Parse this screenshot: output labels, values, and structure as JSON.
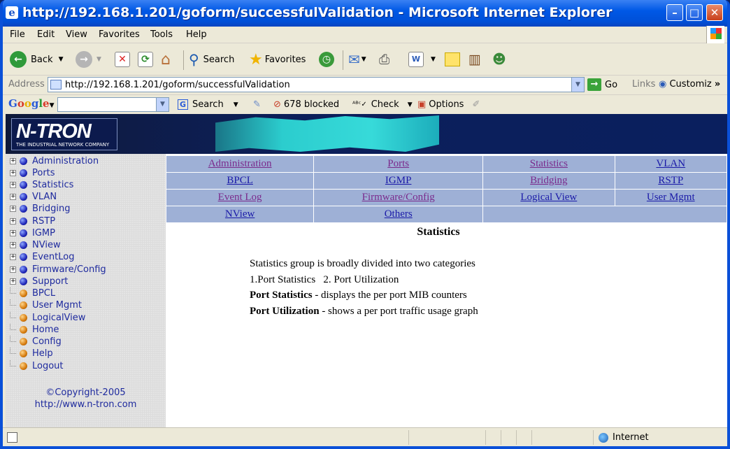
{
  "window": {
    "title": "http://192.168.1.201/goform/successfulValidation - Microsoft Internet Explorer",
    "icon": "ie-icon"
  },
  "menubar": {
    "items": [
      "File",
      "Edit",
      "View",
      "Favorites",
      "Tools",
      "Help"
    ]
  },
  "toolbar": {
    "back": "Back",
    "search": "Search",
    "favorites": "Favorites"
  },
  "address": {
    "label": "Address",
    "url": "http://192.168.1.201/goform/successfulValidation",
    "go": "Go",
    "links": "Links",
    "customize": "Customiz"
  },
  "google": {
    "logo": "Google",
    "search": "Search",
    "blocked": "678 blocked",
    "check": "Check",
    "options": "Options"
  },
  "banner": {
    "logo_main": "N-TRON",
    "logo_sub": "THE INDUSTRIAL NETWORK COMPANY"
  },
  "sidebar": {
    "items": [
      {
        "label": "Administration",
        "type": "folder"
      },
      {
        "label": "Ports",
        "type": "folder"
      },
      {
        "label": "Statistics",
        "type": "folder"
      },
      {
        "label": "VLAN",
        "type": "folder"
      },
      {
        "label": "Bridging",
        "type": "folder"
      },
      {
        "label": "RSTP",
        "type": "folder"
      },
      {
        "label": "IGMP",
        "type": "folder"
      },
      {
        "label": "NView",
        "type": "folder"
      },
      {
        "label": "EventLog",
        "type": "folder"
      },
      {
        "label": "Firmware/Config",
        "type": "folder"
      },
      {
        "label": "Support",
        "type": "folder"
      },
      {
        "label": "BPCL",
        "type": "leaf"
      },
      {
        "label": "User Mgmt",
        "type": "leaf"
      },
      {
        "label": "LogicalView",
        "type": "leaf"
      },
      {
        "label": "Home",
        "type": "leaf"
      },
      {
        "label": "Config",
        "type": "leaf"
      },
      {
        "label": "Help",
        "type": "leaf"
      },
      {
        "label": "Logout",
        "type": "leaf"
      }
    ],
    "copyright": "©Copyright-2005",
    "website": "http://www.n-tron.com"
  },
  "nav": {
    "rows": [
      [
        "Administration",
        "Ports",
        "Statistics",
        "VLAN"
      ],
      [
        "BPCL",
        "IGMP",
        "Bridging",
        "RSTP"
      ],
      [
        "Event Log",
        "Firmware/Config",
        "Logical View",
        "User Mgmt"
      ],
      [
        "NView",
        "Others",
        "",
        ""
      ]
    ]
  },
  "main": {
    "title": "Statistics",
    "intro": "Statistics group is broadly divided into two categories",
    "categories": "1.Port Statistics   2. Port Utilization",
    "port_stats_label": "Port Statistics",
    "port_stats_text": " - displays the per port MIB counters",
    "port_util_label": "Port Utilization",
    "port_util_text": " - shows a per port traffic usage graph"
  },
  "statusbar": {
    "zone": "Internet"
  }
}
